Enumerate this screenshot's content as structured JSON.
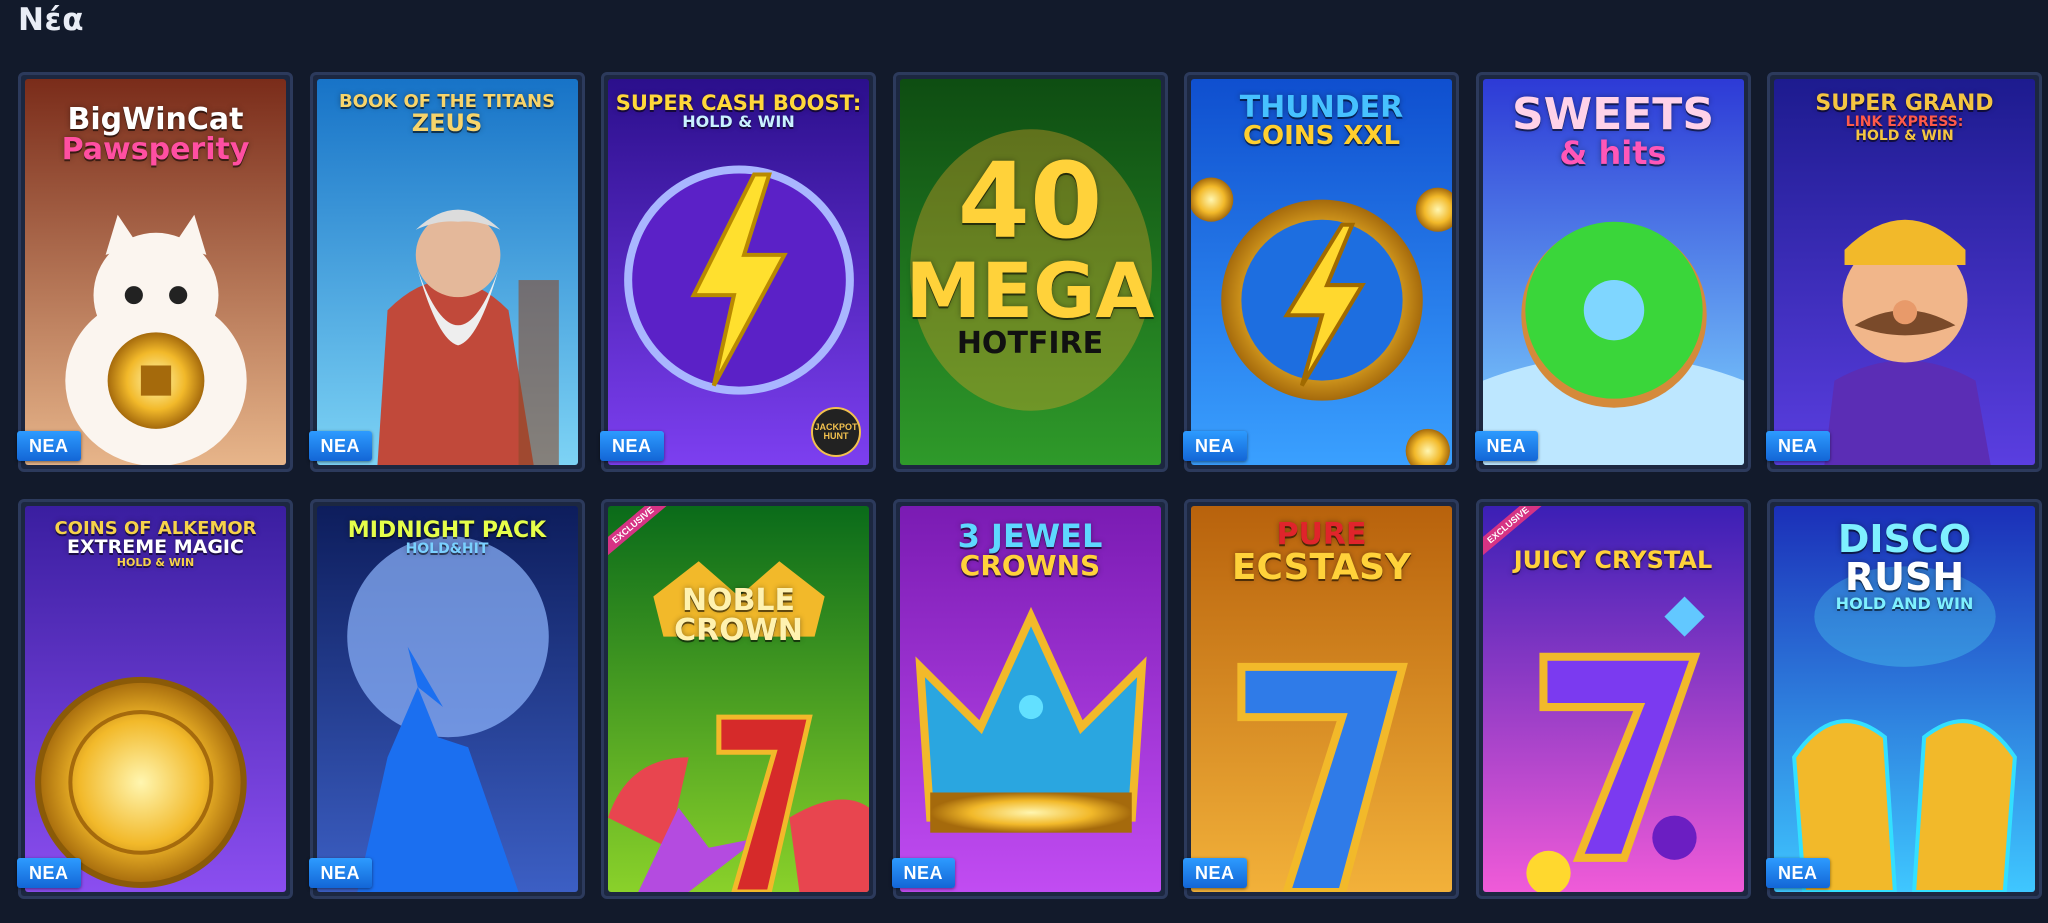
{
  "section": {
    "title": "Νέα"
  },
  "badge_label": "NEA",
  "games": [
    {
      "title": "BigWinCat",
      "title2": "Pawsperity",
      "title3": "",
      "art": "lucky-cat",
      "new": true,
      "exclusive": false,
      "colors": {
        "bg1": "#7a2c1a",
        "bg2": "#e7b58a",
        "text1": "#ffffff",
        "text2": "#ff4fa2"
      }
    },
    {
      "title": "BOOK OF THE TITANS",
      "title2": "ZEUS",
      "title3": "",
      "art": "zeus",
      "new": true,
      "exclusive": false,
      "colors": {
        "bg1": "#1773c7",
        "bg2": "#7dd3f5",
        "text1": "#f7d46b",
        "text2": "#f7d46b"
      }
    },
    {
      "title": "SUPER CASH BOOST:",
      "title2": "HOLD & WIN",
      "title3": "",
      "art": "lightning-circle",
      "new": true,
      "exclusive": false,
      "colors": {
        "bg1": "#2b0f8c",
        "bg2": "#7d3ff0",
        "text1": "#ffd83a",
        "text2": "#c9f1ff"
      },
      "provider": "JACKPOT HUNT"
    },
    {
      "title": "40",
      "title2": "MEGA",
      "title3": "HOTFIRE",
      "art": "mega-fire",
      "new": false,
      "exclusive": false,
      "colors": {
        "bg1": "#0e4d12",
        "bg2": "#2f9a2a",
        "text1": "#ffd23a",
        "text2": "#ffd23a"
      }
    },
    {
      "title": "THUNDER",
      "title2": "COINS XXL",
      "title3": "",
      "art": "thunder-coin",
      "new": true,
      "exclusive": false,
      "colors": {
        "bg1": "#0f4fcf",
        "bg2": "#3aa0ff",
        "text1": "#46c1ff",
        "text2": "#ffcf2e"
      }
    },
    {
      "title": "SWEETS",
      "title2": "& hits",
      "title3": "",
      "art": "donut",
      "new": true,
      "exclusive": false,
      "colors": {
        "bg1": "#2d3ad6",
        "bg2": "#7fd6ff",
        "text1": "#ffd2e9",
        "text2": "#ff57b8"
      }
    },
    {
      "title": "SUPER GRAND",
      "title2": "LINK EXPRESS:",
      "title3": "HOLD & WIN",
      "art": "mustache-man",
      "new": true,
      "exclusive": false,
      "colors": {
        "bg1": "#1d1b8f",
        "bg2": "#5a3ee0",
        "text1": "#f4c542",
        "text2": "#ff5a4a"
      }
    },
    {
      "title": "COINS OF ALKEMOR",
      "title2": "EXTREME MAGIC",
      "title3": "HOLD & WIN",
      "art": "gold-coin",
      "new": true,
      "exclusive": false,
      "colors": {
        "bg1": "#3a1ea0",
        "bg2": "#8b4ef0",
        "text1": "#f6d24a",
        "text2": "#ffffff"
      }
    },
    {
      "title": "MIDNIGHT PACK",
      "title2": "HOLD&HIT",
      "title3": "",
      "art": "wolf",
      "new": true,
      "exclusive": false,
      "colors": {
        "bg1": "#0d1d5c",
        "bg2": "#3c5fc4",
        "text1": "#e6ff4a",
        "text2": "#7ad0ff"
      }
    },
    {
      "title": "NOBLE",
      "title2": "CROWN",
      "title3": "",
      "art": "seven-melon",
      "new": false,
      "exclusive": true,
      "exclusive_label": "EXCLUSIVE",
      "colors": {
        "bg1": "#0a6b1a",
        "bg2": "#8ad12a",
        "text1": "#fff2b0",
        "text2": "#fff2b0"
      }
    },
    {
      "title": "3 JEWEL",
      "title2": "CROWNS",
      "title3": "",
      "art": "jewel-crown",
      "new": true,
      "exclusive": false,
      "colors": {
        "bg1": "#7a1bb3",
        "bg2": "#c14cf2",
        "text1": "#5ed8ff",
        "text2": "#ffd23a"
      }
    },
    {
      "title": "PURE",
      "title2": "ECSTASY",
      "title3": "",
      "art": "blue-seven",
      "new": true,
      "exclusive": false,
      "colors": {
        "bg1": "#b8620c",
        "bg2": "#f2b13a",
        "text1": "#e0242b",
        "text2": "#ffd23a"
      }
    },
    {
      "title": "JUICY CRYSTAL",
      "title2": "",
      "title3": "",
      "art": "purple-seven",
      "new": false,
      "exclusive": true,
      "exclusive_label": "EXCLUSIVE",
      "colors": {
        "bg1": "#3b1fb5",
        "bg2": "#f05bd8",
        "text1": "#ffd23a",
        "text2": "#ffd23a"
      }
    },
    {
      "title": "DISCO",
      "title2": "RUSH",
      "title3": "HOLD AND WIN",
      "art": "neon-gloves",
      "new": true,
      "exclusive": false,
      "colors": {
        "bg1": "#1b2fb8",
        "bg2": "#3fc7ff",
        "text1": "#7ef0ff",
        "text2": "#ffffff"
      }
    }
  ]
}
